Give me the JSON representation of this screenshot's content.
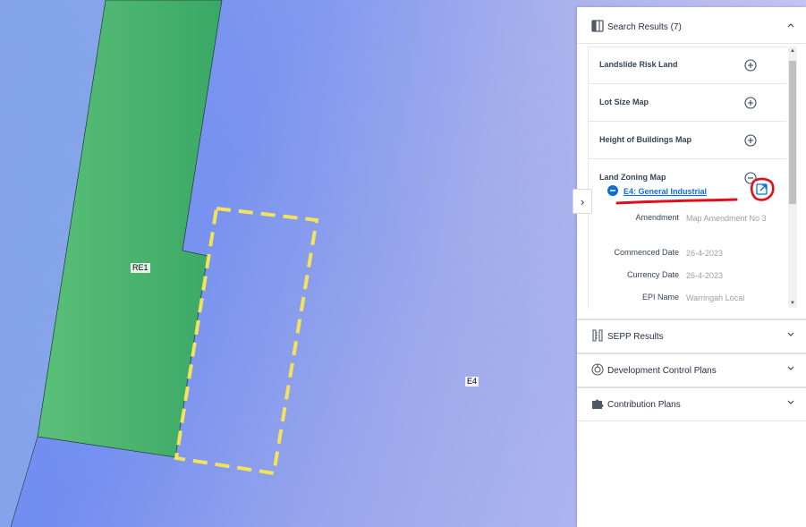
{
  "map": {
    "labels": {
      "re1": "RE1",
      "e4": "E4"
    },
    "colors": {
      "re1_zone": "#4ab86b",
      "e4_zone": "#5a82ee",
      "highlight": "#f3e35a",
      "annotation": "#e0101a"
    }
  },
  "panel": {
    "collapse_glyph": "›",
    "search_results": {
      "label": "Search Results (7)",
      "icon": "map-layers-icon"
    },
    "results": [
      {
        "title": "Landslide Risk Land",
        "state": "collapsed"
      },
      {
        "title": "Lot Size Map",
        "state": "collapsed"
      },
      {
        "title": "Height of Buildings Map",
        "state": "collapsed"
      },
      {
        "title": "Land Zoning Map",
        "state": "expanded"
      }
    ],
    "zoning": {
      "layer": "E4: General Industrial",
      "fields": [
        {
          "key": "Amendment",
          "value": "Map Amendment No 3"
        },
        {
          "key": "Commenced Date",
          "value": "26-4-2023"
        },
        {
          "key": "Currency Date",
          "value": "26-4-2023"
        },
        {
          "key": "EPI Name",
          "value": "Warringah Local"
        }
      ]
    },
    "sections": [
      {
        "label": "SEPP Results",
        "icon": "sepp-icon"
      },
      {
        "label": "Development Control Plans",
        "icon": "development-control-icon"
      },
      {
        "label": "Contribution Plans",
        "icon": "puzzle-icon"
      }
    ]
  }
}
